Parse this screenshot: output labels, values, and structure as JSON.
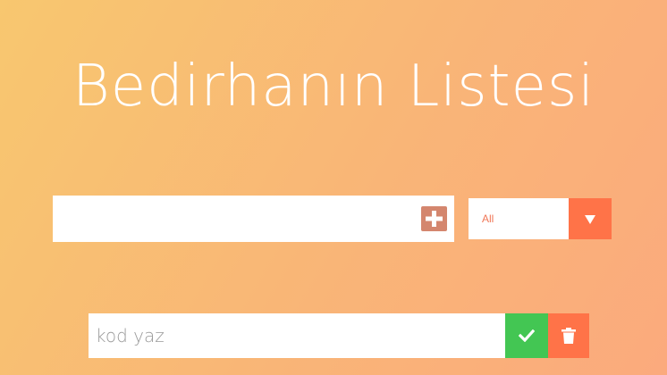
{
  "header": {
    "title": "Bedirhanın Listesi"
  },
  "form": {
    "input_value": "",
    "add_icon": "plus-square-icon",
    "filter": {
      "selected": "All",
      "arrow_icon": "caret-down-icon"
    }
  },
  "todos": [
    {
      "text": "kod yaz",
      "complete_icon": "check-icon",
      "delete_icon": "trash-icon"
    }
  ],
  "colors": {
    "background_start": "#f8c76f",
    "background_end": "#fbaa7d",
    "add_button": "#d4866e",
    "accent_orange": "#ff7348",
    "complete_green": "#43c653",
    "filter_text": "#f07656"
  }
}
